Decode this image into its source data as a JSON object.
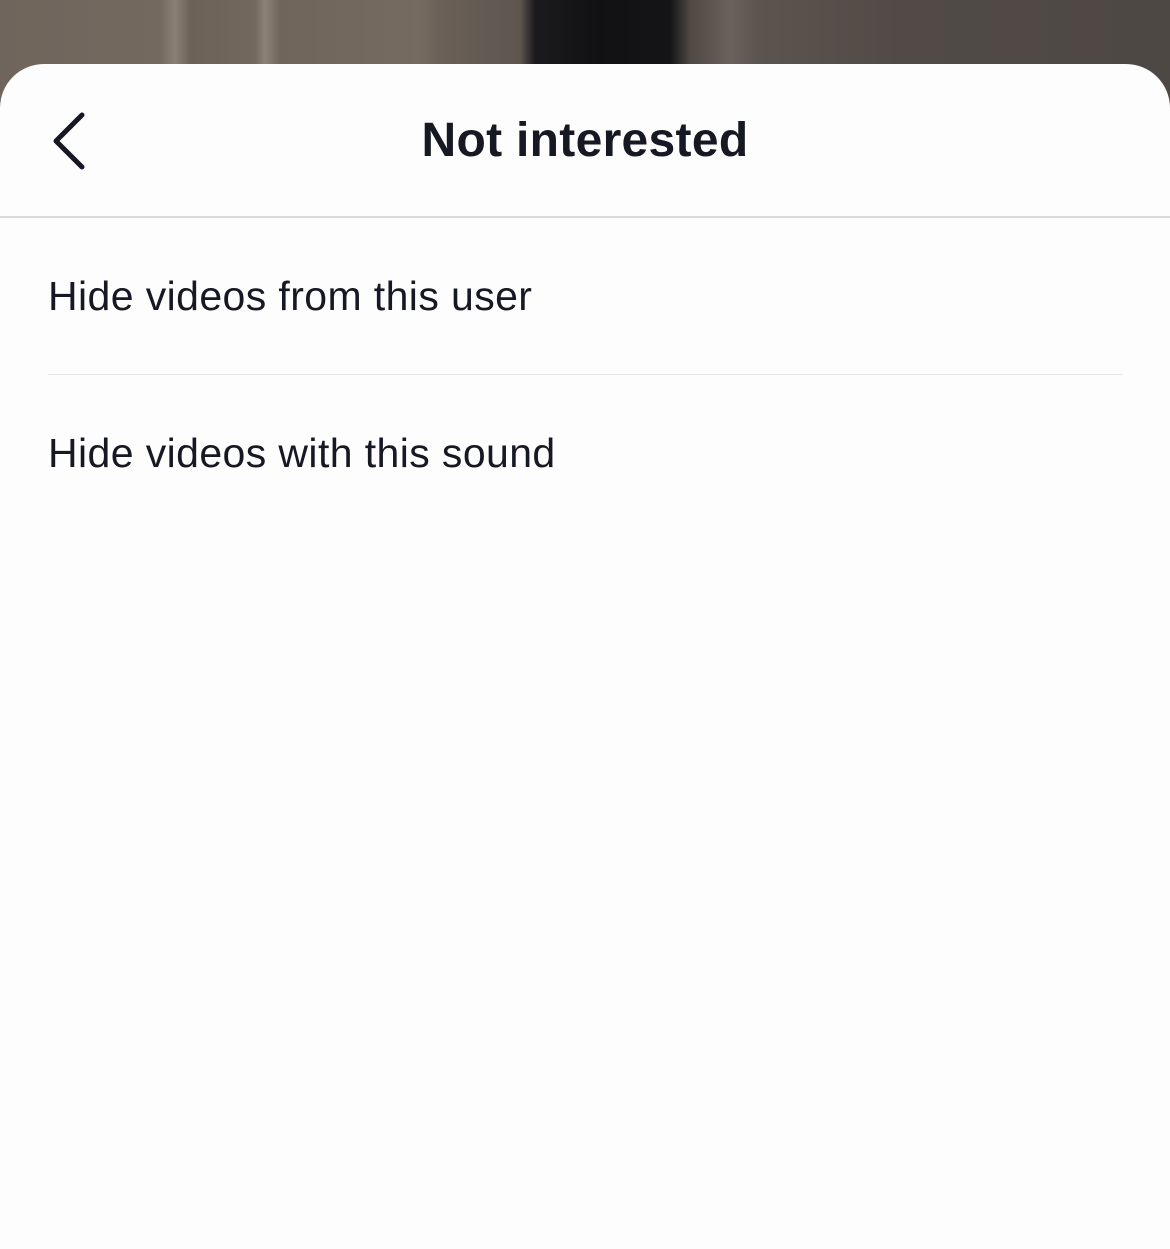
{
  "sheet": {
    "title": "Not interested",
    "back_icon": "chevron-left-icon"
  },
  "options": [
    {
      "label": "Hide videos from this user"
    },
    {
      "label": "Hide videos with this sound"
    }
  ],
  "colors": {
    "sheet_background": "#fefdfe",
    "text_primary": "#161823",
    "divider": "#d9d9db"
  }
}
